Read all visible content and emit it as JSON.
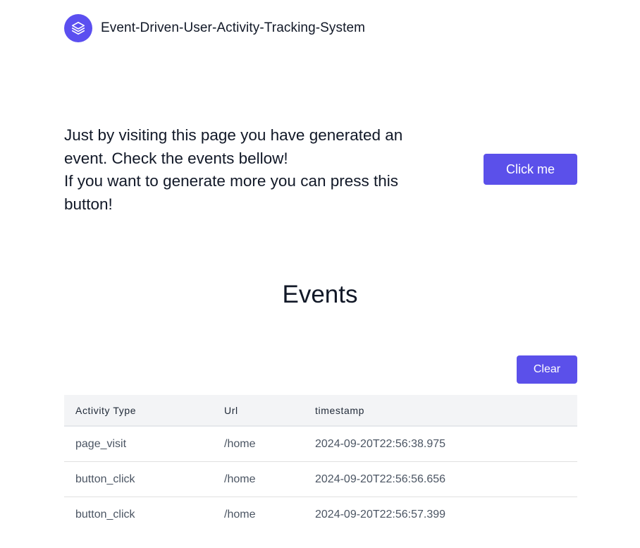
{
  "header": {
    "logo_icon": "layers-icon",
    "app_title": "Event-Driven-User-Activity-Tracking-System"
  },
  "intro": {
    "line1": "Just by visiting this page you have generated an event. Check the events bellow!",
    "line2": "If you want to generate more you can press this button!"
  },
  "actions": {
    "click_label": "Click me",
    "clear_label": "Clear"
  },
  "events": {
    "title": "Events",
    "columns": [
      "Activity Type",
      "Url",
      "timestamp"
    ],
    "rows": [
      [
        "page_visit",
        "/home",
        "2024-09-20T22:56:38.975"
      ],
      [
        "button_click",
        "/home",
        "2024-09-20T22:56:56.656"
      ],
      [
        "button_click",
        "/home",
        "2024-09-20T22:56:57.399"
      ]
    ]
  },
  "colors": {
    "accent": "#5b50ea",
    "text": "#111827",
    "table_header_bg": "#f3f4f6"
  }
}
